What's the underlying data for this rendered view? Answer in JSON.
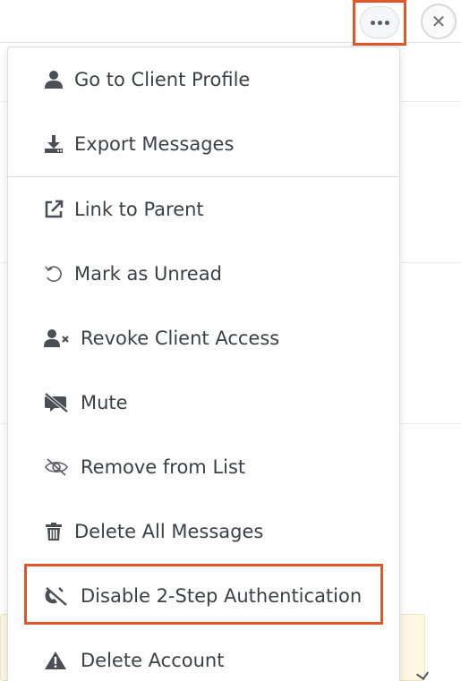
{
  "toolbar": {
    "more_glyph": "•••",
    "close_glyph": "✕",
    "accent_color": "#e0582a"
  },
  "menu": {
    "items": [
      {
        "label": "Go to Client Profile",
        "icon": "user-icon"
      },
      {
        "label": "Export Messages",
        "icon": "download-icon"
      },
      {
        "label": "Link to Parent",
        "icon": "external-link-icon"
      },
      {
        "label": "Mark as Unread",
        "icon": "undo-icon"
      },
      {
        "label": "Revoke Client Access",
        "icon": "user-remove-icon"
      },
      {
        "label": "Mute",
        "icon": "mute-icon"
      },
      {
        "label": "Remove from List",
        "icon": "eye-slash-icon"
      },
      {
        "label": "Delete All Messages",
        "icon": "trash-icon"
      },
      {
        "label": "Disable 2-Step Authentication",
        "icon": "phone-slash-icon"
      },
      {
        "label": "Delete Account",
        "icon": "warning-icon"
      }
    ]
  }
}
